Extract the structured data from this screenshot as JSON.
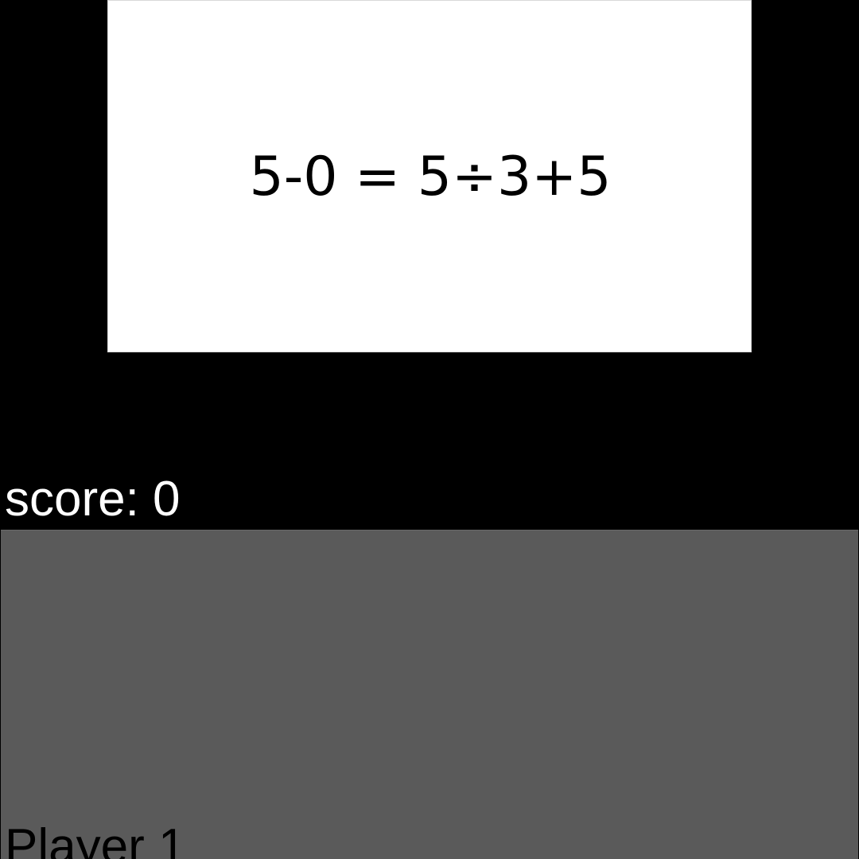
{
  "question": {
    "equation": "5-0 = 5÷3+5"
  },
  "settings": {
    "icon": "gear-icon",
    "color": "#f7f7fb"
  },
  "status": {
    "score_text": "score: 0"
  },
  "player": {
    "label": "Player 1"
  },
  "colors": {
    "background": "#000000",
    "card": "#ffffff",
    "answer_pad": "#5a5a5a"
  }
}
